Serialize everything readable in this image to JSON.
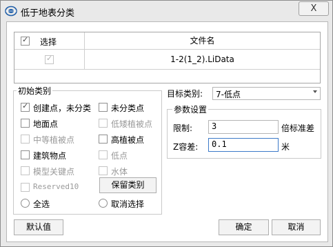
{
  "window": {
    "title": "低于地表分类",
    "close_label": "X"
  },
  "grid": {
    "headers": [
      "选择",
      "文件名"
    ],
    "rows": [
      {
        "checked": true,
        "filename": "1-2(1_2).LiData"
      }
    ]
  },
  "initial_classes": {
    "legend": "初始类别",
    "items": [
      {
        "label": "创建点，未分类",
        "checked": true,
        "enabled": true
      },
      {
        "label": "未分类点",
        "checked": false,
        "enabled": true
      },
      {
        "label": "地面点",
        "checked": false,
        "enabled": true
      },
      {
        "label": "低矮植被点",
        "checked": false,
        "enabled": false
      },
      {
        "label": "中等植被点",
        "checked": false,
        "enabled": false
      },
      {
        "label": "高植被点",
        "checked": false,
        "enabled": true
      },
      {
        "label": "建筑物点",
        "checked": false,
        "enabled": true
      },
      {
        "label": "低点",
        "checked": false,
        "enabled": false
      },
      {
        "label": "模型关键点",
        "checked": false,
        "enabled": false
      },
      {
        "label": "水体",
        "checked": false,
        "enabled": false
      },
      {
        "label": "Reserved10",
        "checked": false,
        "enabled": false
      }
    ],
    "keep_button": "保留类别",
    "select_all": "全选",
    "deselect": "取消选择"
  },
  "target": {
    "label": "目标类别:",
    "value": "7-低点"
  },
  "params": {
    "legend": "参数设置",
    "limit_label": "限制:",
    "limit_value": "3",
    "limit_unit": "倍标准差",
    "tol_label": "Z容差:",
    "tol_value": "0.1",
    "tol_unit": "米"
  },
  "buttons": {
    "default": "默认值",
    "ok": "确定",
    "cancel": "取消"
  }
}
